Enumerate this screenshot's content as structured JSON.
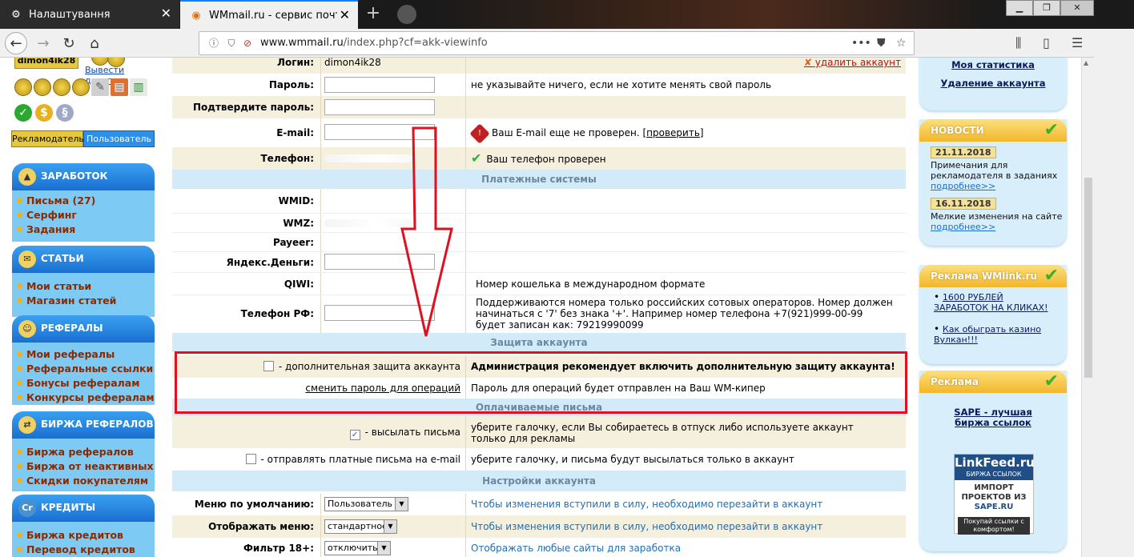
{
  "browser": {
    "tabs": [
      {
        "label": "Налаштування",
        "icon": "gear-icon",
        "active": false
      },
      {
        "label": "WMmail.ru - сервис почтовых",
        "icon": "wmmail-favicon",
        "active": true
      }
    ],
    "url_host": "www.wmmail.ru",
    "url_path": "/index.php?cf=akk-viewinfo",
    "page_actions": "•••"
  },
  "colors": {
    "accent_blue": "#1a6fd0",
    "cream_row": "#f5efdd",
    "section_row": "#d3ebf9",
    "highlight_red": "#e01020"
  },
  "left": {
    "username": "dimon4ik28",
    "withdraw": "Вывести деньги",
    "role_advertiser": "Рекламодатель",
    "role_user": "Пользователь",
    "sections": [
      {
        "title": "ЗАРАБОТОК",
        "icon": "money-icon",
        "items": [
          "Письма (27)",
          "Серфинг",
          "Задания"
        ]
      },
      {
        "title": "СТАТЬИ",
        "icon": "articles-icon",
        "items": [
          "Мои статьи",
          "Магазин статей"
        ]
      },
      {
        "title": "РЕФЕРАЛЫ",
        "icon": "referrals-icon",
        "items": [
          "Мои рефералы",
          "Реферальные ссылки",
          "Бонусы рефералам",
          "Конкурсы рефералам"
        ]
      },
      {
        "title": "БИРЖА РЕФЕРАЛОВ",
        "icon": "exchange-icon",
        "items": [
          "Биржа рефералов",
          "Биржа от неактивных",
          "Скидки покупателям"
        ]
      },
      {
        "title": "КРЕДИТЫ",
        "icon": "credits-icon",
        "icon_text": "Cr",
        "items": [
          "Биржа кредитов",
          "Перевод кредитов"
        ]
      }
    ]
  },
  "form": {
    "login_label": "Логин:",
    "login_value": "dimon4ik28",
    "delete_account": "удалить аккаунт",
    "password_label": "Пароль:",
    "password_hint": "не указывайте ничего, если не хотите менять свой пароль",
    "confirm_label": "Подтвердите пароль:",
    "email_label": "E-mail:",
    "email_status": "Ваш E-mail еще не проверен.",
    "email_check": "проверить",
    "phone_label": "Телефон:",
    "phone_status": "Ваш телефон проверен",
    "section_payment": "Платежные системы",
    "wmid_label": "WMID:",
    "wmz_label": "WMZ:",
    "payeer_label": "Payeer:",
    "yandex_label": "Яндекс.Деньги:",
    "qiwi_label": "QIWI:",
    "qiwi_hint": "Номер кошелька в международном формате",
    "phone_rf_label": "Телефон РФ:",
    "phone_rf_hint": "Поддерживаются номера только российских сотовых операторов. Номер должен начинаться с '7' без знака '+'. Например номер телефона +7(921)999-00-99 будет записан как: 79219990099",
    "section_security": "Защита аккаунта",
    "extra_protection": "- дополнительная защита аккаунта",
    "extra_protection_note": "Администрация рекомендует включить дополнительную защиту аккаунта!",
    "change_op_password": "сменить пароль для операций",
    "op_password_note": "Пароль для операций будет отправлен на Ваш WM-кипер",
    "section_paid": "Оплачиваемые письма",
    "send_letters": "- высылать письма",
    "send_letters_note": "уберите галочку, если Вы собираетесь в отпуск либо используете аккаунт только для рекламы",
    "paid_email": "- отправлять платные письма на e-mail",
    "paid_email_note": "уберите галочку, и письма будут высылаться только в аккаунт",
    "section_settings": "Настройки аккаунта",
    "default_menu_label": "Меню по умолчанию:",
    "default_menu_value": "Пользователь",
    "relogin_note": "Чтобы изменения вступили в силу, необходимо перезайти в аккаунт",
    "show_menu_label": "Отображать меню:",
    "show_menu_value": "стандартное",
    "filter_label": "Фильтр 18+:",
    "filter_value": "отключить",
    "filter_note": "Отображать любые сайты для заработка"
  },
  "right": {
    "my_stats": "Моя статистика",
    "delete_account": "Удаление аккаунта",
    "news_title": "НОВОСТИ",
    "news": [
      {
        "date": "21.11.2018",
        "text": "Примечания для рекламодателя в заданиях",
        "more": "подробнее>>"
      },
      {
        "date": "16.11.2018",
        "text": "Мелкие изменения на сайте",
        "more": "подробнее>>"
      }
    ],
    "wmlink_title": "Реклама WMlink.ru",
    "wmlink_ads": [
      "1600 РУБЛЕЙ ЗАРАБОТОК НА КЛИКАХ!",
      "Как обыграть казино Вулкан!!!"
    ],
    "ad_title": "Реклама",
    "sape": "SAPE - лучшая биржа ссылок",
    "linkfeed_logo": "LinkFeed.ru",
    "linkfeed_sub": "БИРЖА ССЫЛОК",
    "linkfeed_import": "ИМПОРТ ПРОЕКТОВ ИЗ",
    "linkfeed_sape": "SAPE.RU",
    "linkfeed_buy": "Покупай ссылки с комфортом!"
  }
}
